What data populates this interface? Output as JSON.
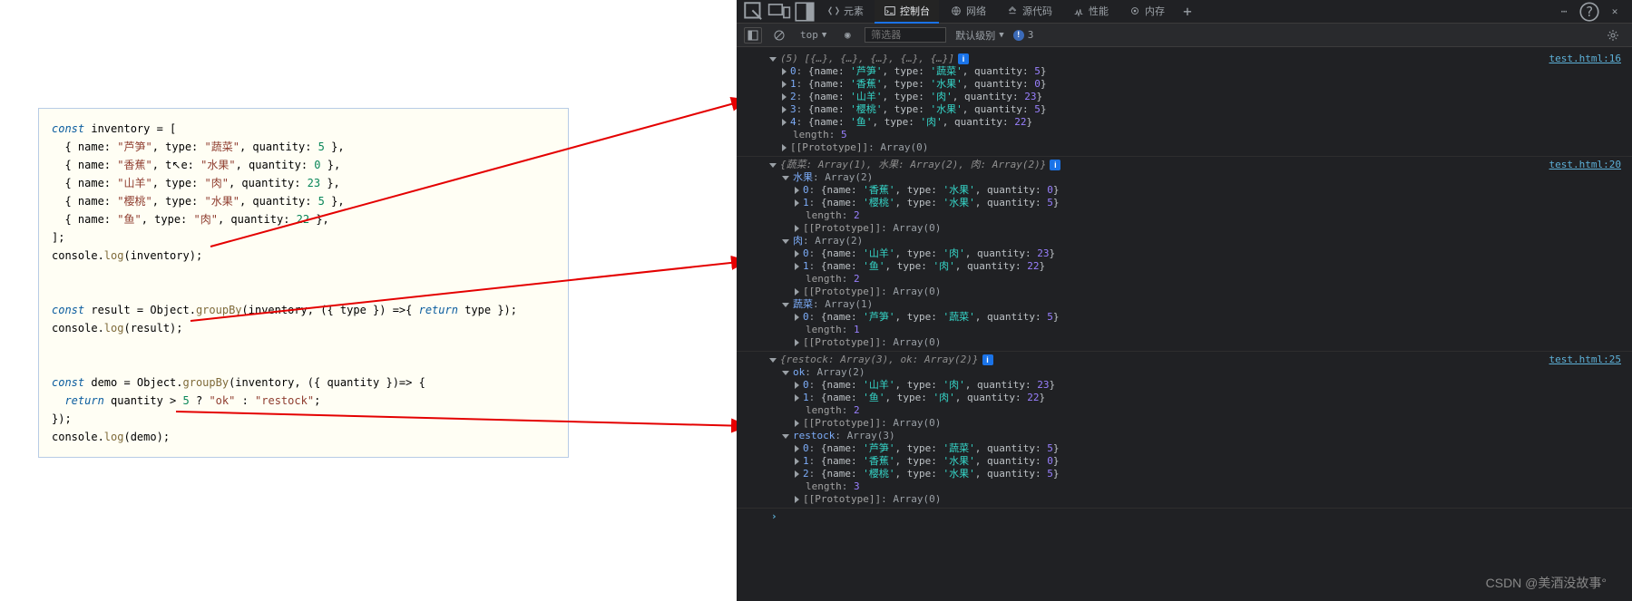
{
  "tabs": {
    "elements": "元素",
    "console": "控制台",
    "network": "网络",
    "sources": "源代码",
    "perf": "性能",
    "memory": "内存"
  },
  "toolbar": {
    "context": "top",
    "eye": "◉",
    "filter_placeholder": "筛选器",
    "levels": "默认级别",
    "errcount": "3"
  },
  "links": {
    "l1": "test.html:16",
    "l2": "test.html:20",
    "l3": "test.html:25"
  },
  "code_tokens": {
    "const": "const",
    "inventory": " inventory = [",
    "i1a": "  { name: ",
    "i1b": "\"芦笋\"",
    "i1c": ", type: ",
    "i1d": "\"蔬菜\"",
    "i1e": ", quantity: ",
    "i1f": "5",
    "i1g": " },",
    "i2a": "  { name: ",
    "i2b": "\"香蕉\"",
    "i2c": ", t",
    "i2cur": "y",
    "i2cc": "e: ",
    "i2d": "\"水果\"",
    "i2e": ", quantity: ",
    "i2f": "0",
    "i2g": " },",
    "i3a": "  { name: ",
    "i3b": "\"山羊\"",
    "i3c": ", type: ",
    "i3d": "\"肉\"",
    "i3e": ", quantity: ",
    "i3f": "23",
    "i3g": " },",
    "i4a": "  { name: ",
    "i4b": "\"樱桃\"",
    "i4c": ", type: ",
    "i4d": "\"水果\"",
    "i4e": ", quantity: ",
    "i4f": "5",
    "i4g": " },",
    "i5a": "  { name: ",
    "i5b": "\"鱼\"",
    "i5c": ", type: ",
    "i5d": "\"肉\"",
    "i5e": ", quantity: ",
    "i5f": "22",
    "i5g": " },",
    "close": "];",
    "log1a": "console.",
    "log1b": "log",
    "log1c": "(inventory);",
    "r1a": " result = Object.",
    "r1b": "groupBy",
    "r1c": "(inventory, ({ type }) =>{ ",
    "r1d": "return",
    "r1e": " type });",
    "log2a": "console.",
    "log2b": "log",
    "log2c": "(result);",
    "d1a": " demo = Object.",
    "d1b": "groupBy",
    "d1c": "(inventory, ({ quantity })=> {",
    "d2a": "  ",
    "d2b": "return",
    "d2c": " quantity > ",
    "d2d": "5",
    "d2e": " ? ",
    "d2f": "\"ok\"",
    "d2g": " : ",
    "d2h": "\"restock\"",
    "d2i": ";",
    "d3": "});",
    "log3a": "console.",
    "log3b": "log",
    "log3c": "(demo);"
  },
  "cons": {
    "hdr1": "(5) [{…}, {…}, {…}, {…}, {…}]",
    "a0": "{name: ",
    "a0b": "'芦笋'",
    "a0c": ", type: ",
    "a0d": "'蔬菜'",
    "a0e": ", quantity: ",
    "a0f": "5",
    "a0g": "}",
    "a1b": "'香蕉'",
    "a1d": "'水果'",
    "a1f": "0",
    "a2b": "'山羊'",
    "a2d": "'肉'",
    "a2f": "23",
    "a3b": "'樱桃'",
    "a3d": "'水果'",
    "a3f": "5",
    "a4b": "'鱼'",
    "a4d": "'肉'",
    "a4f": "22",
    "len": "length",
    "len5": "5",
    "len2": "2",
    "len1": "1",
    "len3": "3",
    "proto": "[[Prototype]]",
    "arr0": "Array(0)",
    "hdr2a": "{蔬菜: Array(1), 水果: Array(2), 肉: Array(2)}",
    "shuiguo": "水果",
    "arr2": "Array(2)",
    "rou": "肉",
    "shucai": "蔬菜",
    "arr1": "Array(1)",
    "arr3": "Array(3)",
    "hdr3": "{restock: Array(3), ok: Array(2)}",
    "ok": "ok",
    "restock": "restock",
    "idx0": "0",
    "idx1": "1",
    "idx2": "2",
    "idx3": "3",
    "idx4": "4"
  },
  "watermark": "CSDN @美酒没故事°"
}
